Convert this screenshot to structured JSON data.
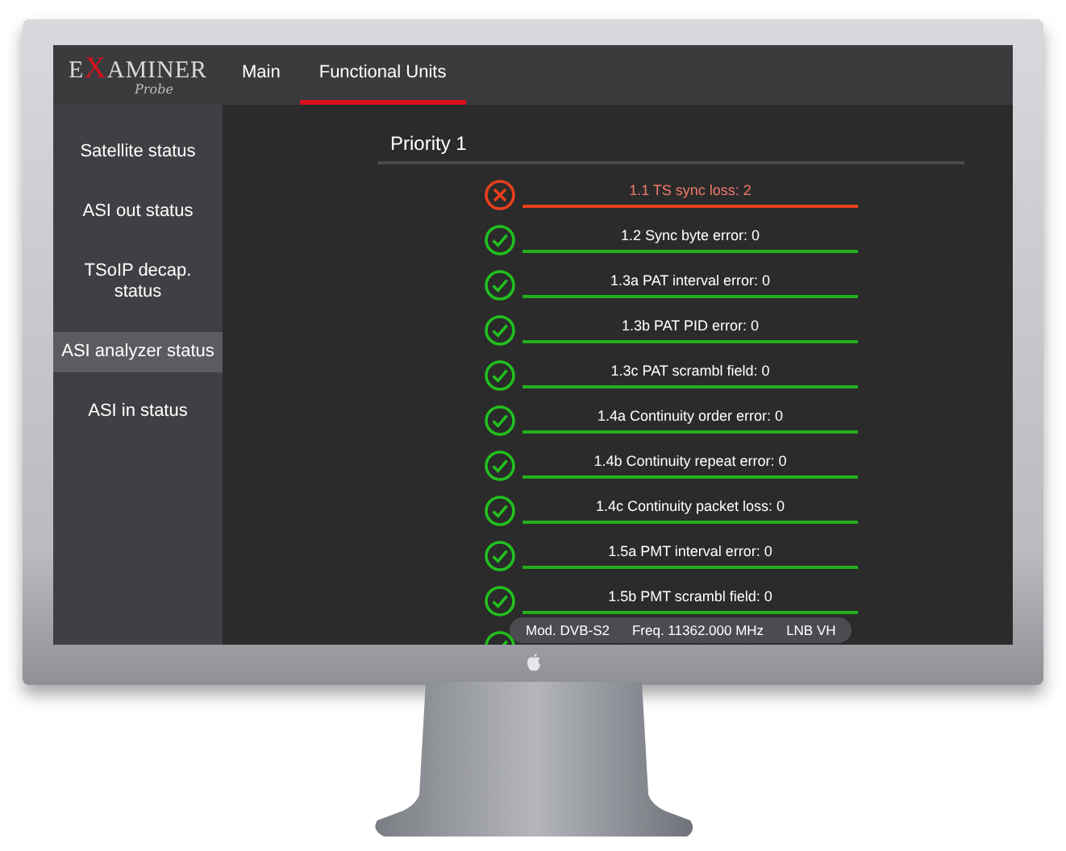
{
  "logo": {
    "pre": "E",
    "mark": "X",
    "post": "AMINER",
    "subtitle": "Probe"
  },
  "tabs": [
    {
      "label": "Main",
      "selected": false
    },
    {
      "label": "Functional Units",
      "selected": true
    }
  ],
  "sidebar": {
    "items": [
      {
        "label": "Satellite status",
        "selected": false
      },
      {
        "label": "ASI out status",
        "selected": false
      },
      {
        "label": "TSoIP decap. status",
        "selected": false
      },
      {
        "label": "ASI analyzer status",
        "selected": true
      },
      {
        "label": "ASI in status",
        "selected": false
      }
    ]
  },
  "section": {
    "title": "Priority 1"
  },
  "checks": [
    {
      "label": "1.1 TS sync loss: 2",
      "kind": "error"
    },
    {
      "label": "1.2 Sync byte error: 0",
      "kind": "ok"
    },
    {
      "label": "1.3a PAT interval error: 0",
      "kind": "ok"
    },
    {
      "label": "1.3b PAT PID error: 0",
      "kind": "ok"
    },
    {
      "label": "1.3c PAT scrambl field: 0",
      "kind": "ok"
    },
    {
      "label": "1.4a Continuity order error: 0",
      "kind": "ok"
    },
    {
      "label": "1.4b Continuity repeat error: 0",
      "kind": "ok"
    },
    {
      "label": "1.4c Continuity packet loss: 0",
      "kind": "ok"
    },
    {
      "label": "1.5a PMT interval error: 0",
      "kind": "ok"
    },
    {
      "label": "1.5b PMT scrambl field: 0",
      "kind": "ok"
    },
    {
      "kind": "ok"
    }
  ],
  "status_bar": [
    "Mod. DVB-S2",
    "Freq. 11362.000 MHz",
    "LNB VH"
  ]
}
